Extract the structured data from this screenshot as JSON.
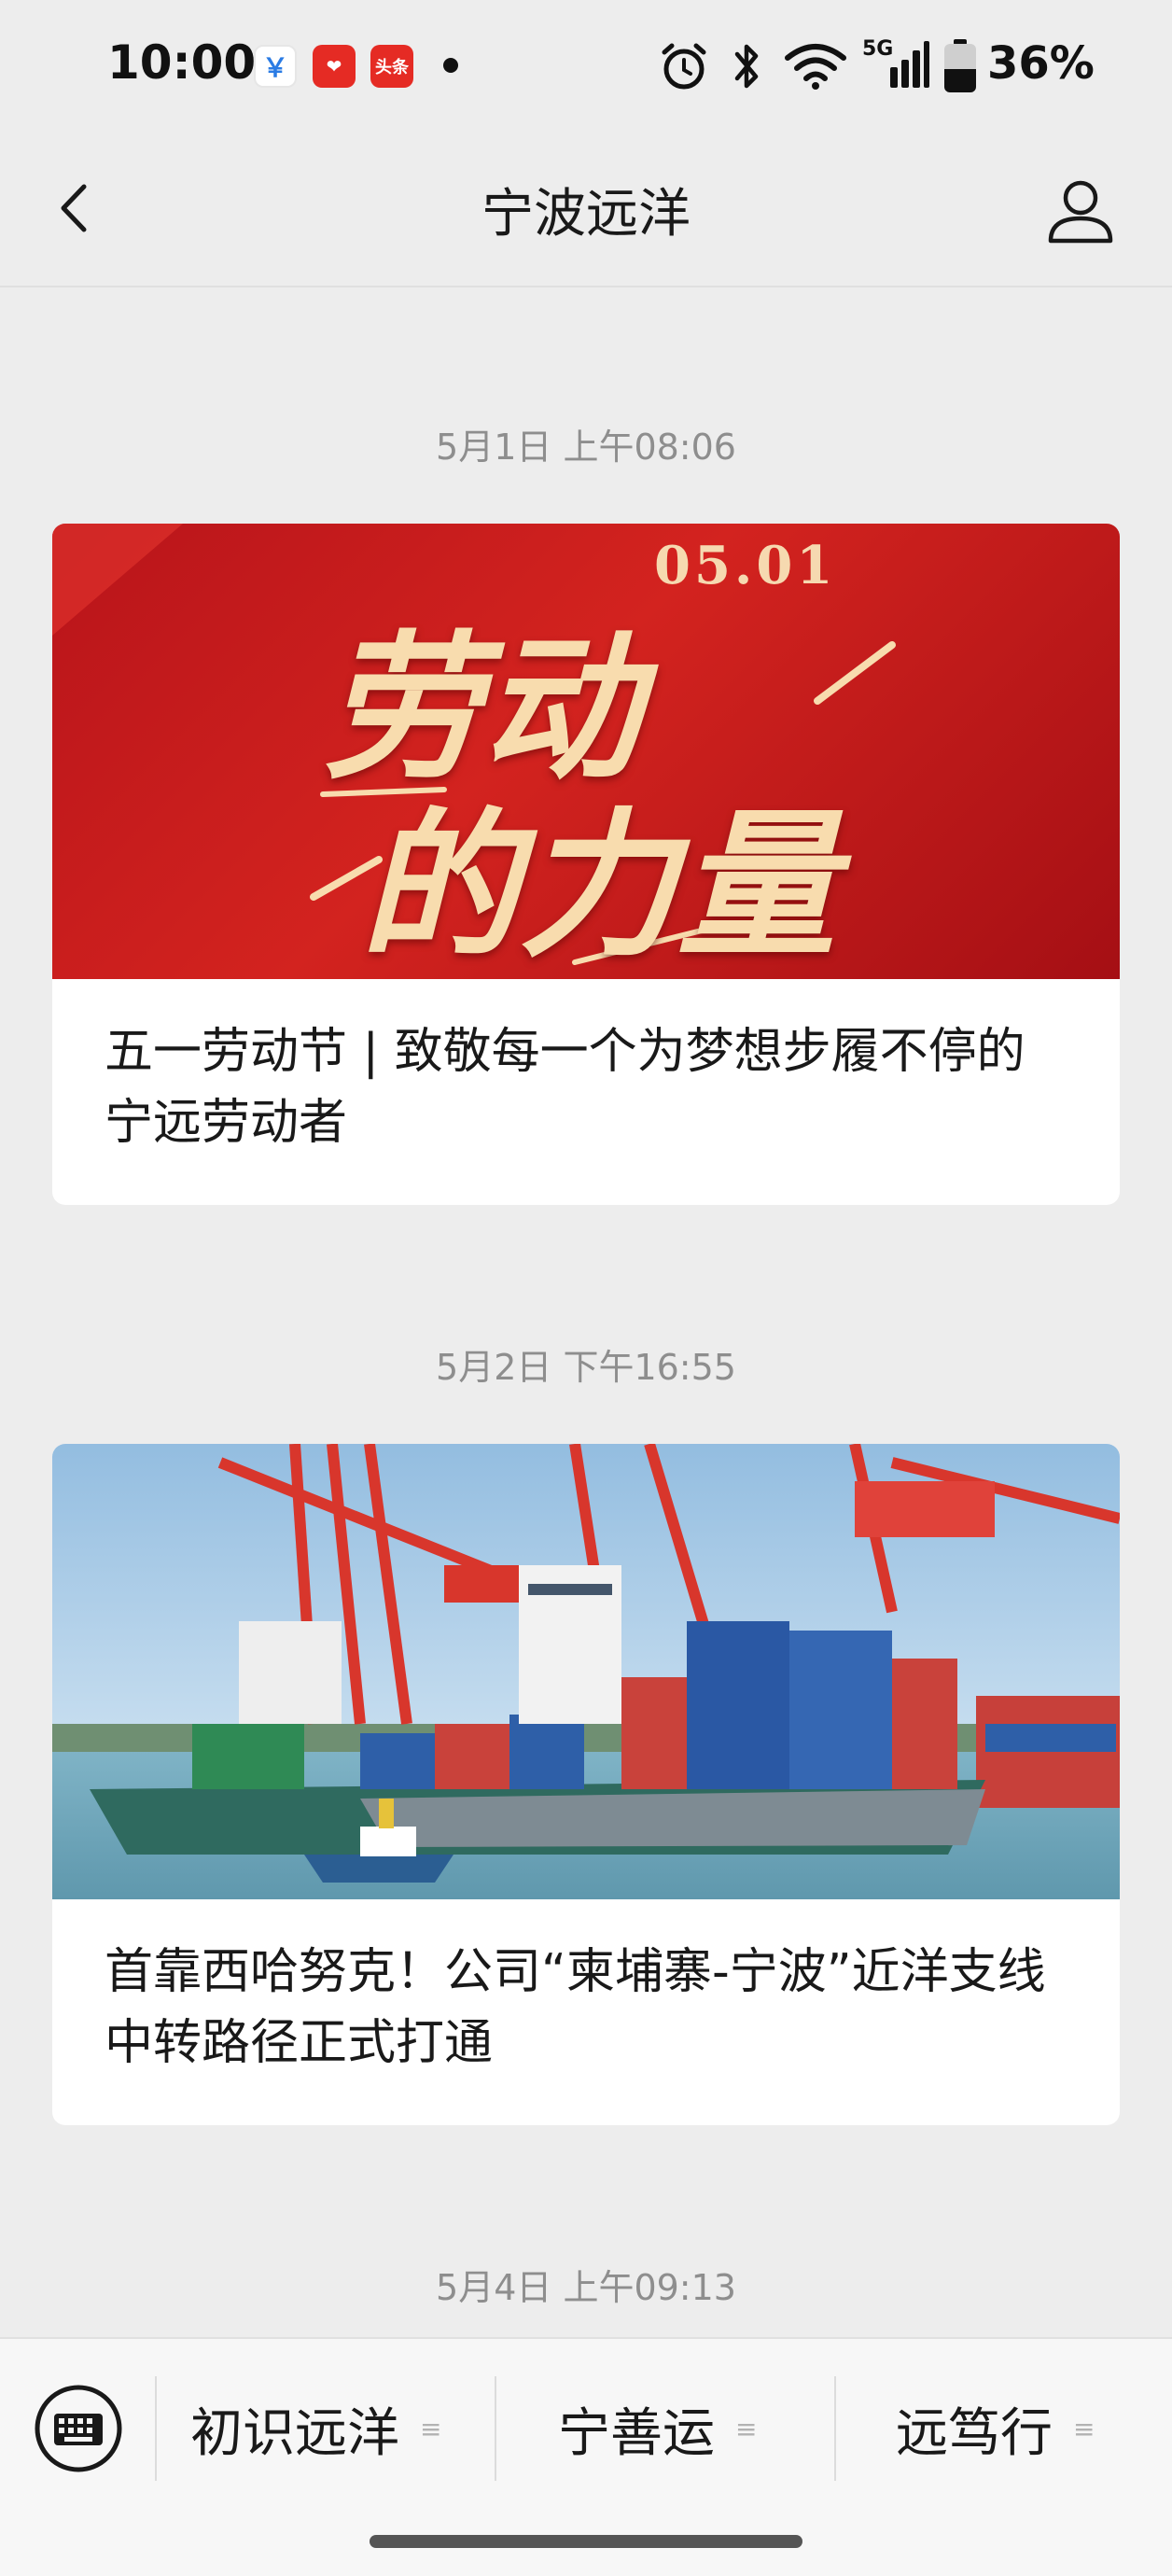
{
  "status_bar": {
    "time": "10:00",
    "notifications": [
      {
        "icon": "pay-app-icon",
        "label": "￥"
      },
      {
        "icon": "heart-app-icon",
        "label": "❤"
      },
      {
        "icon": "toutiao-app-icon",
        "label": "头条"
      }
    ],
    "network": "5G",
    "battery": "36%"
  },
  "nav": {
    "title": "宁波远洋",
    "back_icon": "chevron-left-icon",
    "profile_icon": "person-icon"
  },
  "feed": [
    {
      "timestamp": "5月1日 上午08:06",
      "image": {
        "date_text": "05.01",
        "line1": "劳动",
        "line2": "的力量"
      },
      "title": "五一劳动节 | 致敬每一个为梦想步履不停的宁远劳动者"
    },
    {
      "timestamp": "5月2日 下午16:55",
      "image": {
        "description_icon": "port-ship-image"
      },
      "title": "首靠西哈努克！公司“柬埔寨-宁波”近洋支线中转路径正式打通"
    },
    {
      "timestamp": "5月4日 上午09:13"
    }
  ],
  "bottom_menu": {
    "keyboard_icon": "keyboard-icon",
    "items": [
      {
        "label": "初识远洋"
      },
      {
        "label": "宁善运"
      },
      {
        "label": "远笃行"
      }
    ],
    "menu_glyph": "≡"
  }
}
